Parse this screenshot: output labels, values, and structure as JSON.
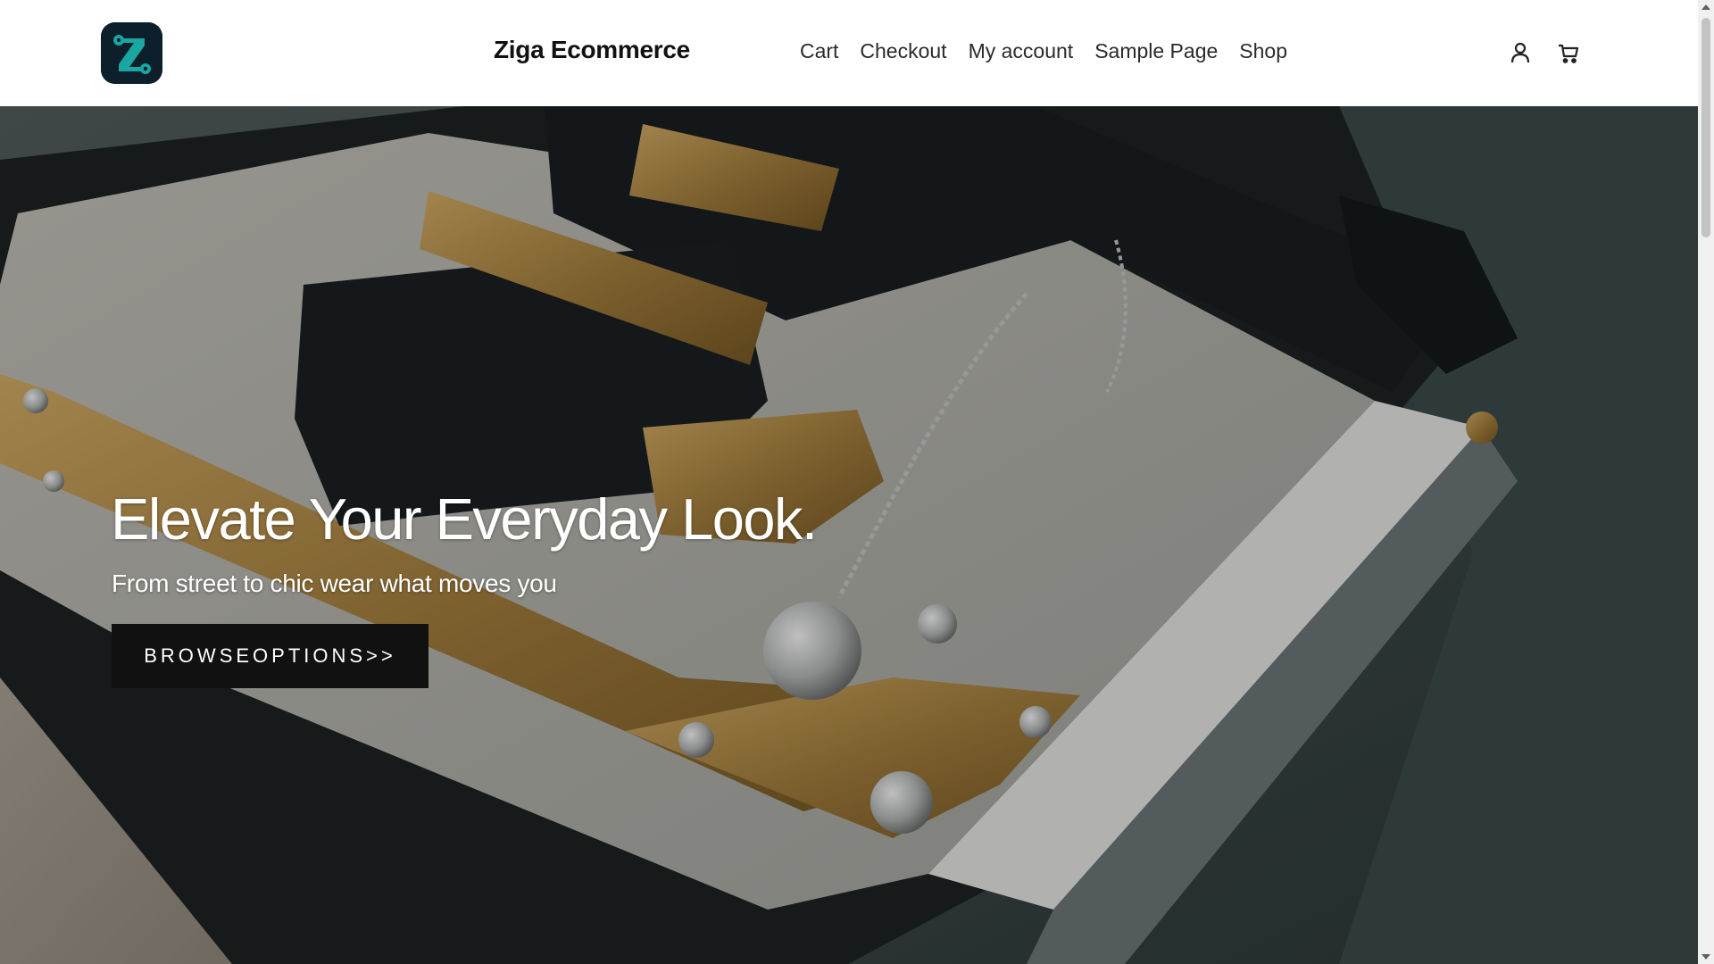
{
  "site": {
    "title": "Ziga Ecommerce",
    "brand_color": "#1aa7a1",
    "logo_bg": "#0c1f2b"
  },
  "nav": {
    "items": [
      {
        "label": "Cart"
      },
      {
        "label": "Checkout"
      },
      {
        "label": "My account"
      },
      {
        "label": "Sample Page"
      },
      {
        "label": "Shop"
      }
    ],
    "icons": [
      "user-icon",
      "cart-icon"
    ]
  },
  "hero": {
    "title": "Elevate Your Everyday Look.",
    "subtitle": "From street to chic wear what moves you",
    "button_label": "BROWSEOPTIONS>>",
    "button_color": "#111111"
  }
}
